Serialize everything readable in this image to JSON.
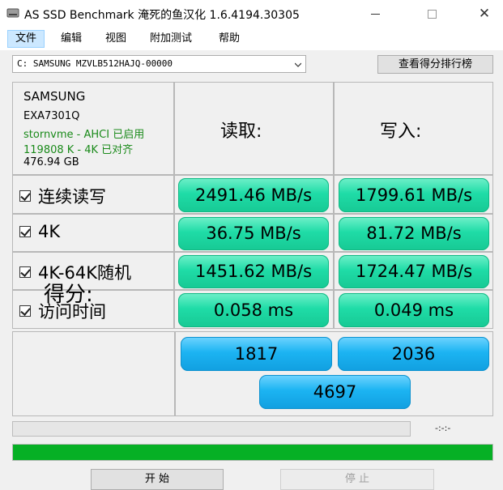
{
  "window": {
    "title": "AS SSD Benchmark 淹死的鱼汉化 1.6.4194.30305"
  },
  "menu": {
    "items": [
      {
        "label": "文件"
      },
      {
        "label": "编辑"
      },
      {
        "label": "视图"
      },
      {
        "label": "附加测试"
      },
      {
        "label": "帮助"
      }
    ]
  },
  "toolbar": {
    "drive": "C: SAMSUNG MZVLB512HAJQ-00000",
    "rank_button": "查看得分排行榜"
  },
  "drive_info": {
    "brand": "SAMSUNG",
    "firmware": "EXA7301Q",
    "driver": "stornvme - AHCI 已启用",
    "alignment": "119808 K - 4K 已对齐",
    "capacity": "476.94 GB"
  },
  "columns": {
    "read": "读取:",
    "write": "写入:"
  },
  "rows": [
    {
      "label": "连续读写",
      "read": "2491.46 MB/s",
      "write": "1799.61 MB/s",
      "checked": true
    },
    {
      "label": "4K",
      "read": "36.75 MB/s",
      "write": "81.72 MB/s",
      "checked": true
    },
    {
      "label": "4K-64K随机",
      "read": "1451.62 MB/s",
      "write": "1724.47 MB/s",
      "checked": true
    },
    {
      "label": "访问时间",
      "read": "0.058 ms",
      "write": "0.049 ms",
      "checked": true
    }
  ],
  "score": {
    "label": "得分:",
    "read": "1817",
    "write": "2036",
    "total": "4697"
  },
  "status": {
    "time": "-:-:-",
    "main_progress": 1.0
  },
  "buttons": {
    "start": "开 始",
    "stop": "停 止"
  },
  "colors": {
    "result": "#1fdca7",
    "score": "#1cb4f2",
    "progress": "#06b025",
    "info_text": "#1a8a1a"
  }
}
